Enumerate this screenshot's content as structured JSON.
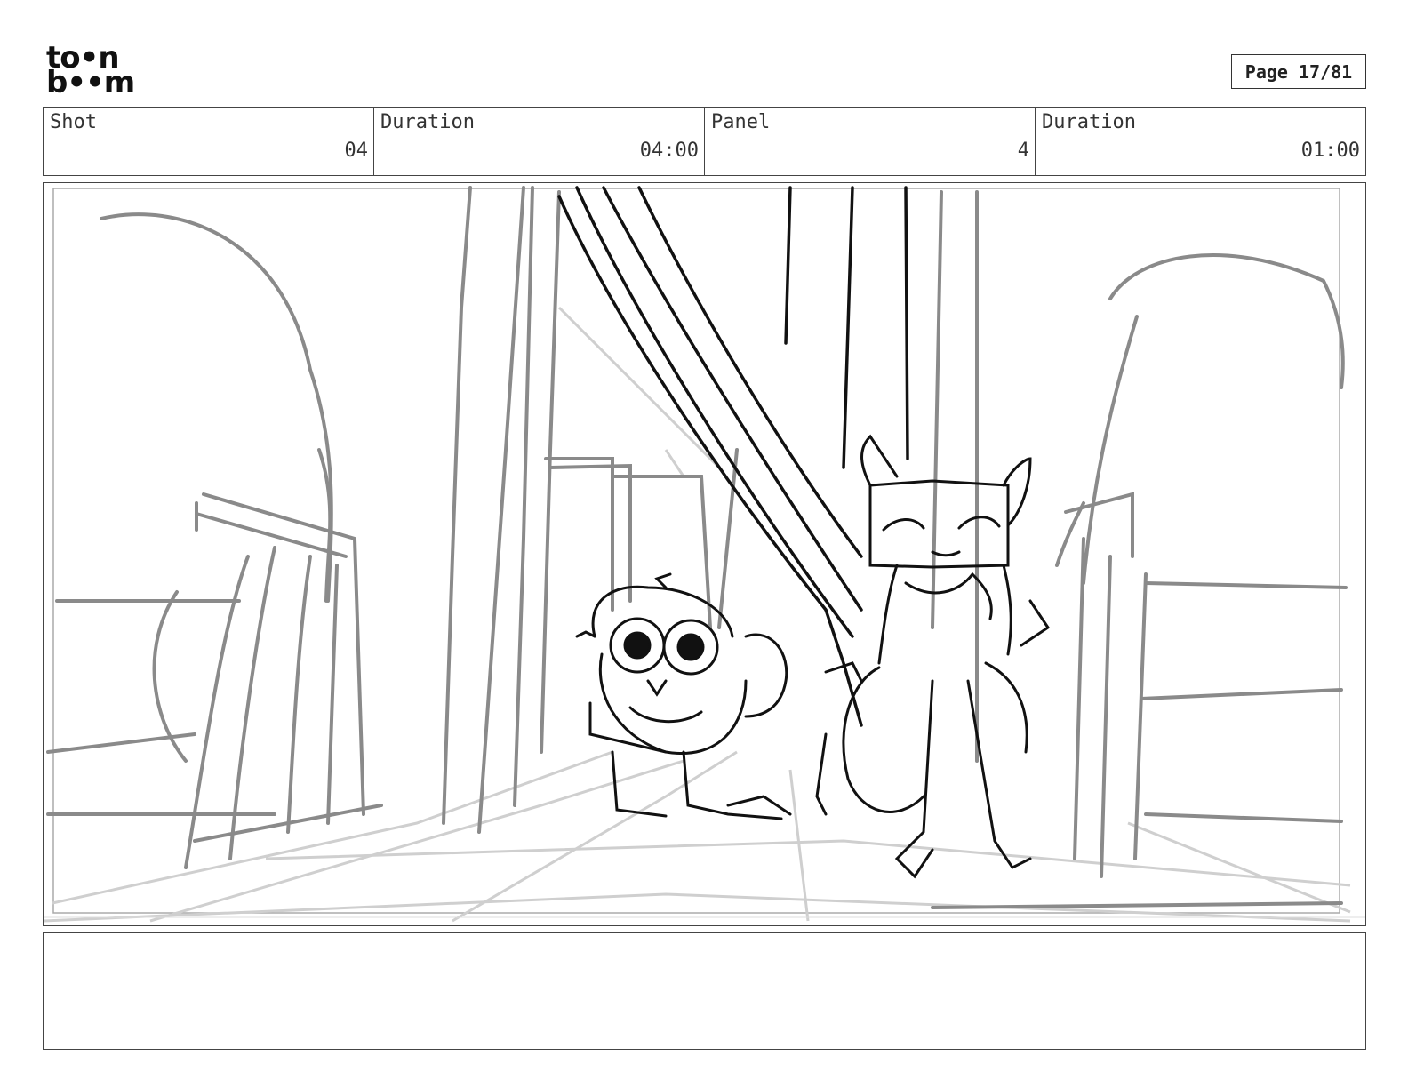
{
  "logo": {
    "line1": "to•n",
    "line2": "b••m"
  },
  "page": {
    "label": "Page 17/81"
  },
  "info": {
    "shot_label": "Shot",
    "shot_value": "04",
    "shot_duration_label": "Duration",
    "shot_duration_value": "04:00",
    "panel_label": "Panel",
    "panel_value": "4",
    "panel_duration_label": "Duration",
    "panel_duration_value": "01:00"
  },
  "notes": {
    "text": ""
  }
}
